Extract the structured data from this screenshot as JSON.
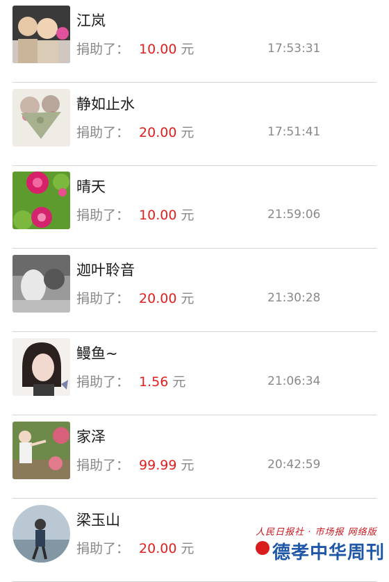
{
  "donations": [
    {
      "name": "江岚",
      "prefix": "捐助了：",
      "amount": "10.00",
      "unit": "元",
      "time": "17:53:31",
      "avatar": "avatar-photo-two-children"
    },
    {
      "name": "静如止水",
      "prefix": "捐助了：",
      "amount": "20.00",
      "unit": "元",
      "time": "17:51:41",
      "avatar": "avatar-photo-dried-flower-heart"
    },
    {
      "name": "晴天",
      "prefix": "捐助了：",
      "amount": "10.00",
      "unit": "元",
      "time": "21:59:06",
      "avatar": "avatar-photo-pink-peonies"
    },
    {
      "name": "迦叶聆音",
      "prefix": "捐助了：",
      "amount": "20.00",
      "unit": "元",
      "time": "21:30:28",
      "avatar": "avatar-photo-man-with-mask"
    },
    {
      "name": "鳗鱼~",
      "prefix": "捐助了：",
      "amount": "1.56",
      "unit": "元",
      "time": "21:06:34",
      "avatar": "avatar-photo-girl-short-hair"
    },
    {
      "name": "家泽",
      "prefix": "捐助了：",
      "amount": "99.99",
      "unit": "元",
      "time": "20:42:59",
      "avatar": "avatar-photo-child-garden"
    },
    {
      "name": "梁玉山",
      "prefix": "捐助了：",
      "amount": "20.00",
      "unit": "元",
      "time": "",
      "avatar": "avatar-photo-person-beach"
    }
  ],
  "watermark": {
    "top": "人民日报社 · 市场报 网络版",
    "main": "德孝中华周刊"
  },
  "colors": {
    "amount": "#e0201e",
    "text_gray": "#888888",
    "divider": "#d4d4d4",
    "watermark_blue": "#1f57a8",
    "watermark_red": "#c8161d"
  }
}
